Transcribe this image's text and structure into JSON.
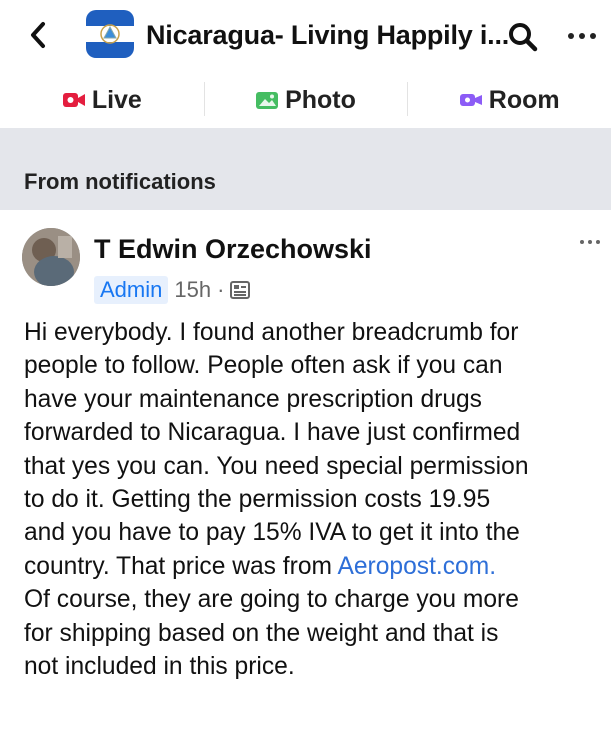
{
  "header": {
    "title": "Nicaragua- Living Happily i..."
  },
  "actions": {
    "live": "Live",
    "photo": "Photo",
    "room": "Room"
  },
  "notifications": {
    "label": "From notifications"
  },
  "post": {
    "author": "T Edwin Orzechowski",
    "role": "Admin",
    "time": "15h",
    "separator": "·",
    "lines": [
      "Hi everybody.  I found another breadcrumb for",
      "people to follow. People often ask if you can",
      "have your maintenance prescription drugs",
      "forwarded to Nicaragua.  I have just confirmed",
      "that yes you can. You need special permission",
      "to do it. Getting the permission costs 19.95",
      "and you have to pay 15% IVA to get it into the"
    ],
    "line8_prefix": "country.  That price was from ",
    "link_text": "Aeropost.com.",
    "lines_after": [
      "Of course, they are going to charge you more",
      "for shipping based on the weight and that is",
      "not included in this price."
    ]
  },
  "colors": {
    "accent_blue": "#1877f2",
    "live_red": "#e41e3f",
    "photo_green": "#45bd62",
    "room_purple": "#8c5cf6",
    "band_gray": "#e4e6eb"
  },
  "icons": {
    "back": "chevron-left-icon",
    "search": "search-icon",
    "more": "more-icon",
    "live": "live-video-icon",
    "photo": "photo-icon",
    "room": "room-icon",
    "privacy": "group-privacy-icon"
  }
}
